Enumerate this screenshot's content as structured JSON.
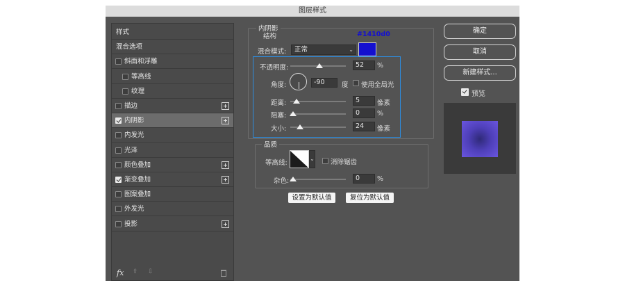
{
  "dialog": {
    "title": "图层样式"
  },
  "styles_panel": {
    "items": [
      {
        "label": "样式",
        "checkbox": false,
        "checked": false,
        "plus": false,
        "selected": false
      },
      {
        "label": "混合选项",
        "checkbox": false,
        "checked": false,
        "plus": false,
        "selected": false
      },
      {
        "label": "斜面和浮雕",
        "checkbox": true,
        "checked": false,
        "plus": false,
        "selected": false
      },
      {
        "label": "等高线",
        "checkbox": true,
        "checked": false,
        "plus": false,
        "selected": false,
        "indent": true
      },
      {
        "label": "纹理",
        "checkbox": true,
        "checked": false,
        "plus": false,
        "selected": false,
        "indent": true
      },
      {
        "label": "描边",
        "checkbox": true,
        "checked": false,
        "plus": true,
        "selected": false
      },
      {
        "label": "内阴影",
        "checkbox": true,
        "checked": true,
        "plus": true,
        "selected": true
      },
      {
        "label": "内发光",
        "checkbox": true,
        "checked": false,
        "plus": false,
        "selected": false
      },
      {
        "label": "光泽",
        "checkbox": true,
        "checked": false,
        "plus": false,
        "selected": false
      },
      {
        "label": "颜色叠加",
        "checkbox": true,
        "checked": false,
        "plus": true,
        "selected": false
      },
      {
        "label": "渐变叠加",
        "checkbox": true,
        "checked": true,
        "plus": true,
        "selected": false
      },
      {
        "label": "图案叠加",
        "checkbox": true,
        "checked": false,
        "plus": false,
        "selected": false
      },
      {
        "label": "外发光",
        "checkbox": true,
        "checked": false,
        "plus": false,
        "selected": false
      },
      {
        "label": "投影",
        "checkbox": true,
        "checked": false,
        "plus": true,
        "selected": false
      }
    ],
    "footer": {
      "fx_label": "fx",
      "up_arrow": "⇧",
      "down_arrow": "⇩"
    }
  },
  "inner_shadow": {
    "section_title": "内阴影",
    "structure": {
      "title": "结构",
      "color_hex": "#1410d0",
      "blend_mode_label": "混合模式:",
      "blend_mode_value": "正常",
      "swatch_color": "#1410d0",
      "opacity_label": "不透明度:",
      "opacity_value": "52",
      "opacity_unit": "%",
      "opacity_level": 52,
      "angle_label": "角度:",
      "angle_value": "-90",
      "angle_unit": "度",
      "global_light_label": "使用全局光",
      "global_light_checked": false,
      "distance_label": "距离:",
      "distance_value": "5",
      "distance_unit": "像素",
      "choke_label": "阻塞:",
      "choke_value": "0",
      "choke_unit": "%",
      "size_label": "大小:",
      "size_value": "24",
      "size_unit": "像素"
    },
    "quality": {
      "title": "品质",
      "contour_label": "等高线:",
      "antialias_label": "消除锯齿",
      "antialias_checked": false,
      "noise_label": "杂色:",
      "noise_value": "0",
      "noise_unit": "%"
    },
    "buttons": {
      "make_default": "设置为默认值",
      "reset_default": "复位为默认值"
    }
  },
  "right_panel": {
    "ok": "确定",
    "cancel": "取消",
    "new_style": "新建样式...",
    "preview_label": "预览",
    "preview_checked": true,
    "accent_color": "#2d8de0"
  }
}
